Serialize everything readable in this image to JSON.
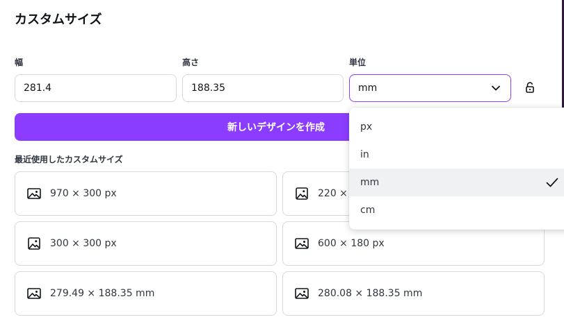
{
  "dialog": {
    "title": "カスタムサイズ"
  },
  "fields": {
    "width": {
      "label": "幅",
      "value": "281.4"
    },
    "height": {
      "label": "高さ",
      "value": "188.35"
    },
    "unit": {
      "label": "単位",
      "value": "mm"
    }
  },
  "actions": {
    "create_label": "新しいデザインを作成"
  },
  "recent": {
    "title": "最近使用したカスタムサイズ",
    "items": [
      {
        "label": "970 × 300 px",
        "icon": "image-landscape-icon"
      },
      {
        "label": "220 × 2",
        "icon": "image-square-icon"
      },
      {
        "label": "300 × 300 px",
        "icon": "image-square-icon"
      },
      {
        "label": "600 × 180 px",
        "icon": "image-landscape-icon"
      },
      {
        "label": "279.49 × 188.35 mm",
        "icon": "image-landscape-icon"
      },
      {
        "label": "280.08 × 188.35 mm",
        "icon": "image-landscape-icon"
      }
    ]
  },
  "unit_dropdown": {
    "options": [
      {
        "label": "px"
      },
      {
        "label": "in"
      },
      {
        "label": "mm",
        "selected": true
      },
      {
        "label": "cm"
      }
    ]
  },
  "colors": {
    "accent": "#8b3dff",
    "selected_bg": "#f0f1f5",
    "border": "#d6d8dc"
  }
}
